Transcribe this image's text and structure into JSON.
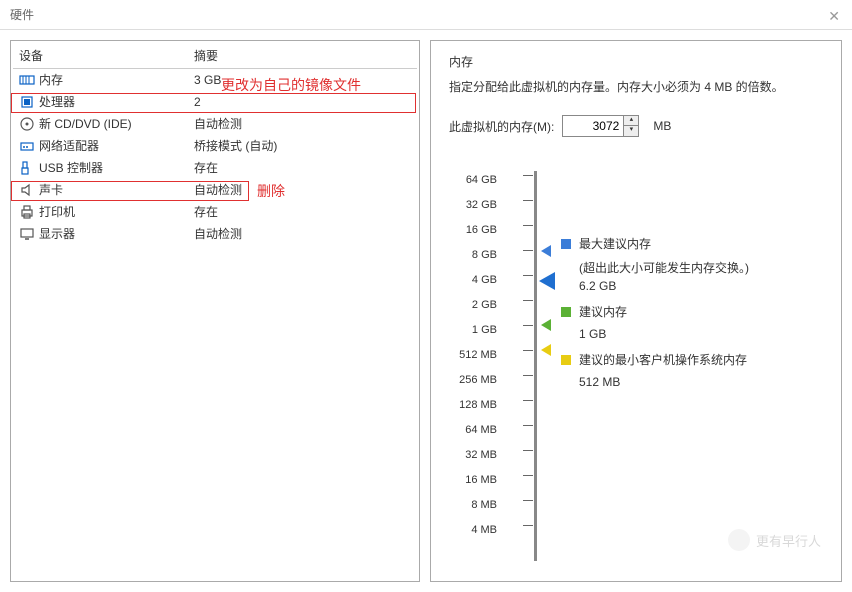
{
  "window": {
    "title": "硬件"
  },
  "table": {
    "headers": [
      "设备",
      "摘要"
    ],
    "rows": [
      {
        "name": "内存",
        "summary": "3 GB",
        "icon": "memory-icon"
      },
      {
        "name": "处理器",
        "summary": "2",
        "icon": "cpu-icon"
      },
      {
        "name": "新 CD/DVD (IDE)",
        "summary": "自动检测",
        "icon": "cd-icon"
      },
      {
        "name": "网络适配器",
        "summary": "桥接模式 (自动)",
        "icon": "network-icon"
      },
      {
        "name": "USB 控制器",
        "summary": "存在",
        "icon": "usb-icon"
      },
      {
        "name": "声卡",
        "summary": "自动检测",
        "icon": "sound-icon"
      },
      {
        "name": "打印机",
        "summary": "存在",
        "icon": "printer-icon"
      },
      {
        "name": "显示器",
        "summary": "自动检测",
        "icon": "display-icon"
      }
    ]
  },
  "annotations": {
    "change_image": "更改为自己的镜像文件",
    "delete": "删除"
  },
  "memory": {
    "section_title": "内存",
    "description": "指定分配给此虚拟机的内存量。内存大小必须为 4 MB 的倍数。",
    "field_label": "此虚拟机的内存(M):",
    "value": "3072",
    "unit": "MB",
    "scale": [
      "64 GB",
      "32 GB",
      "16 GB",
      "8 GB",
      "4 GB",
      "2 GB",
      "1 GB",
      "512 MB",
      "256 MB",
      "128 MB",
      "64 MB",
      "32 MB",
      "16 MB",
      "8 MB",
      "4 MB"
    ],
    "legend": {
      "max": {
        "label": "最大建议内存",
        "note": "(超出此大小可能发生内存交换。)",
        "value": "6.2 GB"
      },
      "rec": {
        "label": "建议内存",
        "value": "1 GB"
      },
      "min": {
        "label": "建议的最小客户机操作系统内存",
        "value": "512 MB"
      }
    }
  },
  "watermark": {
    "text": "更有早行人"
  }
}
